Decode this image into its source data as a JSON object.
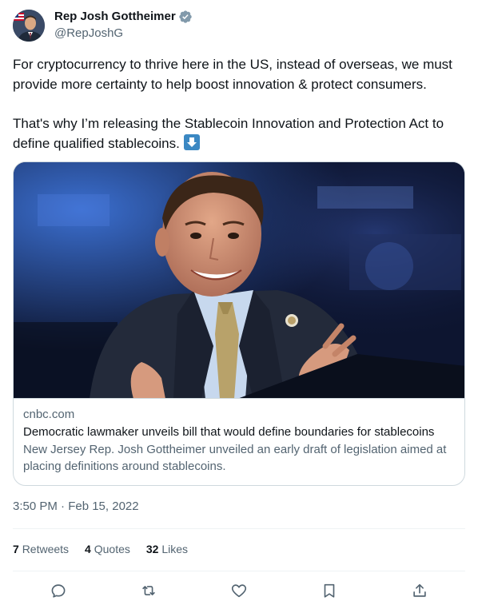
{
  "author": {
    "name": "Rep Josh Gottheimer",
    "handle": "@RepJoshG",
    "verified_color": "#829aab"
  },
  "tweet": {
    "paragraph1": "For cryptocurrency to thrive here in the US, instead of overseas, we must provide more certainty to help boost innovation & protect consumers.",
    "paragraph2": "That's why I’m releasing the Stablecoin Innovation and Protection Act to define qualified stablecoins.",
    "emoji": "down-arrow-emoji"
  },
  "card": {
    "domain": "cnbc.com",
    "title": "Democratic lawmaker unveils bill that would define boundaries for stablecoins",
    "description": "New Jersey Rep. Josh Gottheimer unveiled an early draft of legislation aimed at placing definitions around stablecoins."
  },
  "timestamp": "3:50 PM · Feb 15, 2022",
  "stats": {
    "retweets_count": "7",
    "retweets_label": "Retweets",
    "quotes_count": "4",
    "quotes_label": "Quotes",
    "likes_count": "32",
    "likes_label": "Likes"
  },
  "actions": [
    "reply-icon",
    "retweet-icon",
    "like-icon",
    "bookmark-icon",
    "share-icon"
  ],
  "colors": {
    "text": "#0f1419",
    "secondary": "#536471",
    "border": "#cfd9de",
    "emoji_blue": "#3b88c3"
  }
}
